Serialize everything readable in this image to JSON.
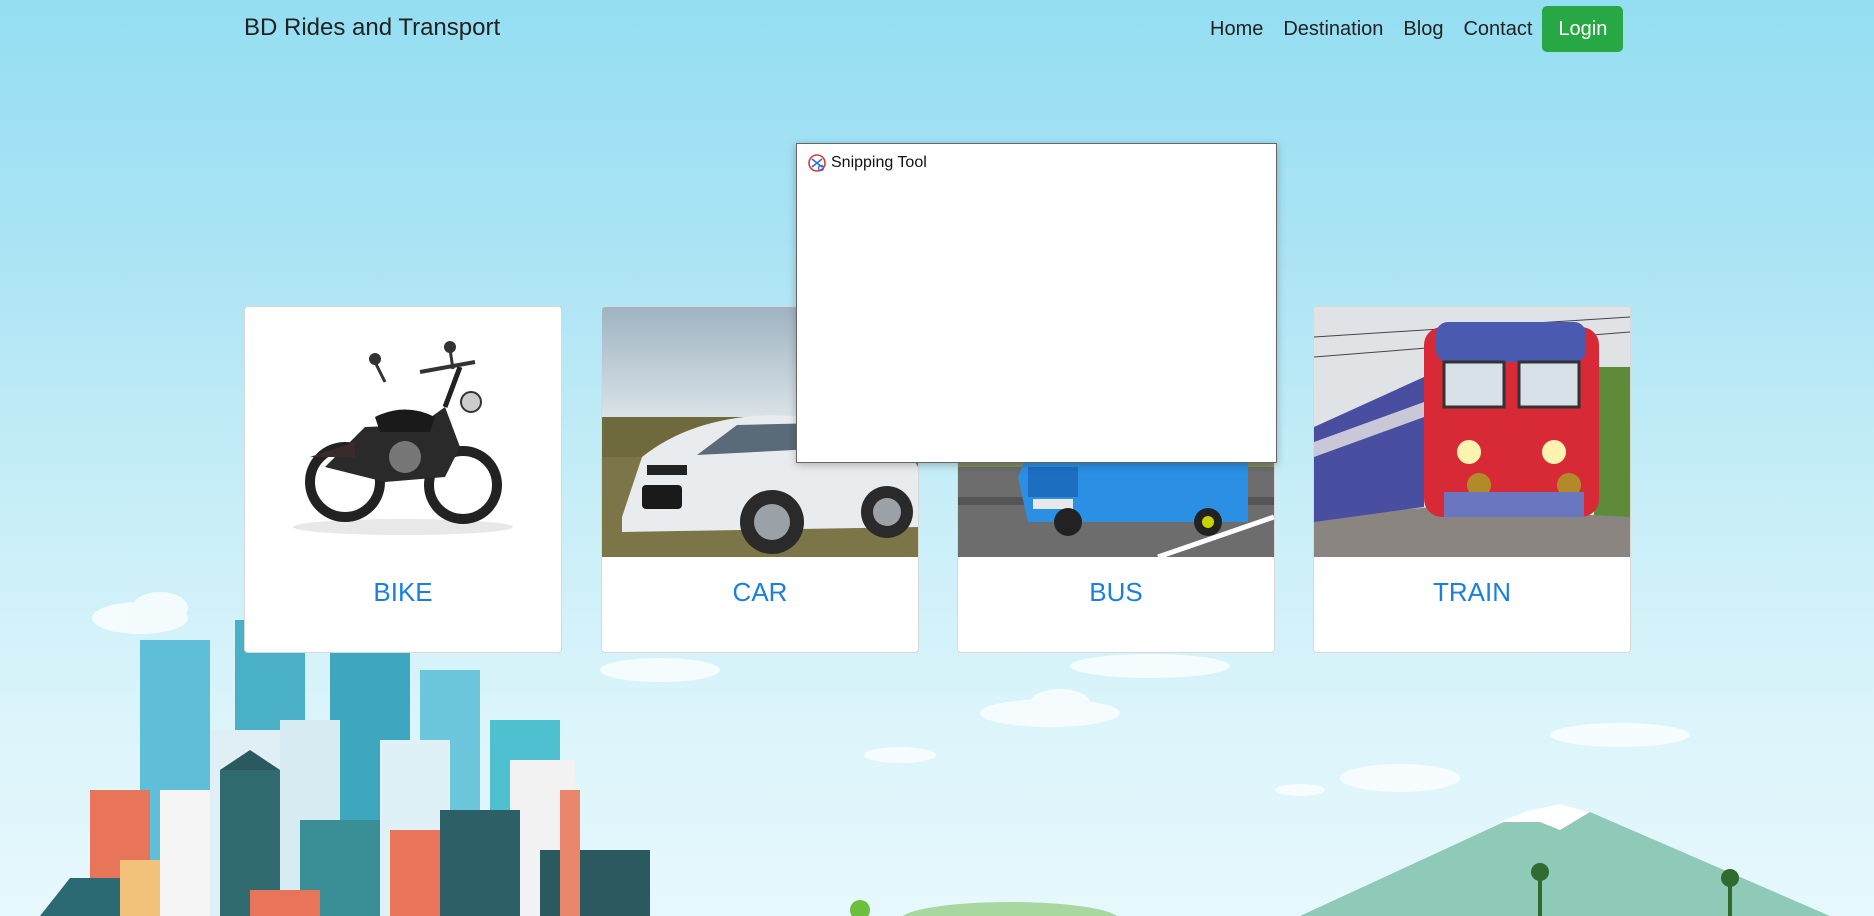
{
  "navbar": {
    "brand": "BD Rides and Transport",
    "links": [
      "Home",
      "Destination",
      "Blog",
      "Contact"
    ],
    "login_label": "Login"
  },
  "cards": [
    {
      "title": "BIKE",
      "image_icon": "motorcycle-photo"
    },
    {
      "title": "CAR",
      "image_icon": "car-photo"
    },
    {
      "title": "BUS",
      "image_icon": "bus-photo"
    },
    {
      "title": "TRAIN",
      "image_icon": "train-photo"
    }
  ],
  "snipping_tool": {
    "title": "Snipping Tool",
    "icon": "scissors-icon"
  },
  "colors": {
    "accent": "#1a7fe0",
    "login": "#28a745",
    "sky_top": "#94def2"
  }
}
